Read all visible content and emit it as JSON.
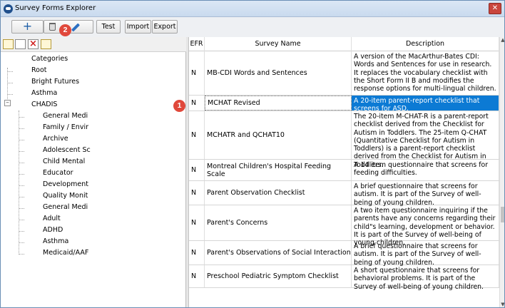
{
  "window": {
    "title": "Survey Forms Explorer",
    "close_glyph": "✕"
  },
  "toolbar": {
    "add_glyph": "+",
    "test_label": "Test",
    "import_label": "Import",
    "export_label": "Export"
  },
  "callouts": {
    "one": "1",
    "two": "2"
  },
  "tree": {
    "header": "Categories",
    "items": [
      "Root",
      "Bright Futures",
      "Asthma",
      "CHADIS",
      "General Medi",
      "Family / Envir",
      "Archive",
      "Adolescent Sc",
      "Child Mental",
      "Educator",
      "Development",
      "Quality Monit",
      "General Medi",
      "Adult",
      "ADHD",
      "Asthma",
      "Medicaid/AAF"
    ],
    "expander_glyph": "–"
  },
  "grid": {
    "columns": {
      "efr": "EFR",
      "name": "Survey Name",
      "description": "Description"
    },
    "rows": [
      {
        "efr": "N",
        "name": "MB-CDI Words and Sentences",
        "description": "A version of the MacArthur-Bates CDI: Words and Sentences for use in research. It replaces the vocabulary checklist with the Short Form II B and modifies the response options for multi-lingual children.",
        "selected": false
      },
      {
        "efr": "N",
        "name": "MCHAT Revised",
        "description": "A 20-item parent-report checklist that screens for ASD.",
        "selected": true
      },
      {
        "efr": "N",
        "name": "MCHATR and QCHAT10",
        "description": "The 20-item M-CHAT-R is a parent-report checklist derived from the Checklist for Autism in Toddlers. The 25-item Q-CHAT (Quantitative Checklist for Autism in Toddlers) is a parent-report checklist derived from the Checklist for Autism in Toddlers.",
        "selected": false
      },
      {
        "efr": "N",
        "name": "Montreal Children's Hospital Feeding Scale",
        "description": "A 14 item questionnaire that screens for feeding difficulties.",
        "selected": false
      },
      {
        "efr": "N",
        "name": "Parent Observation Checklist",
        "description": "A brief questionnaire that screens for autism. It is part of the Survey of well-being of young children.",
        "selected": false
      },
      {
        "efr": "N",
        "name": "Parent's Concerns",
        "description": "A two item questionnaire inquiring if the parents have any concerns regarding their child\"s learning, development or behavior. It is part of the Survey of well-being of young children.",
        "selected": false
      },
      {
        "efr": "N",
        "name": "Parent's Observations of Social Interaction",
        "description": "A brief questionnaire that screens for autism. It is part of the Survey of well-being of young children.",
        "selected": false
      },
      {
        "efr": "N",
        "name": "Preschool Pediatric Symptom Checklist",
        "description": "A short questionnaire that screens for behavioral problems. It is part of the Survey of well-being of young children.",
        "selected": false
      }
    ]
  },
  "colors": {
    "selection": "#0c7ad4",
    "callout": "#e0483b"
  }
}
